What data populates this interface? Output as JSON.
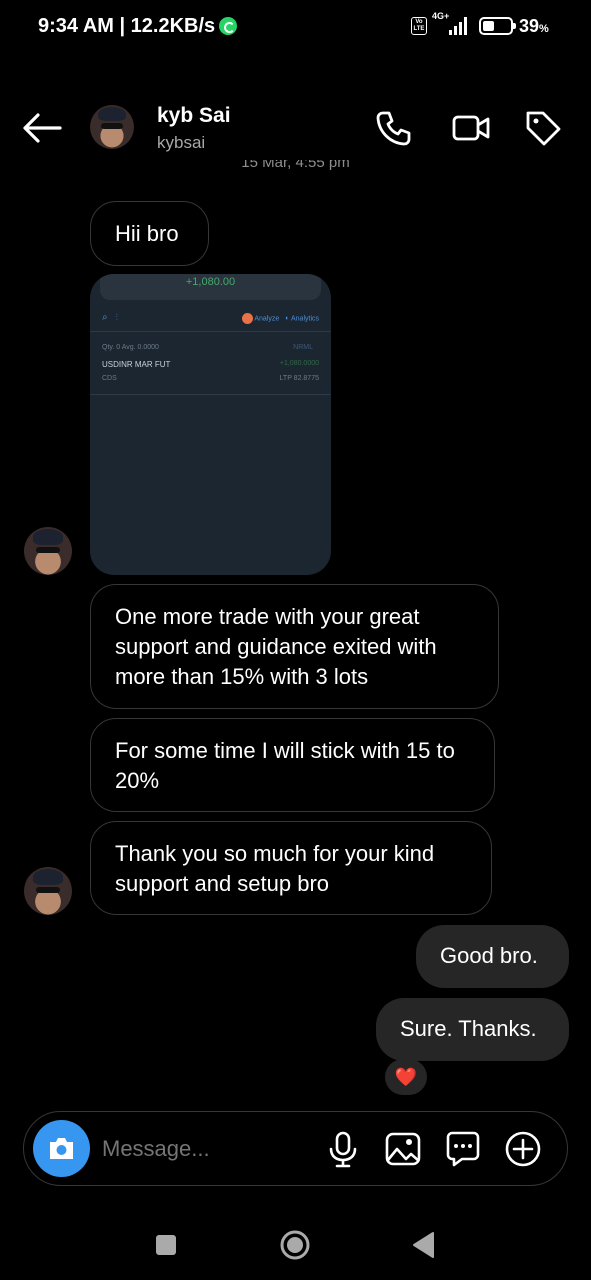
{
  "status_bar": {
    "time": "9:34 AM | 12.2KB/s",
    "volte": "Vo LTE",
    "network": "4G+",
    "battery": "39",
    "battery_unit": "%"
  },
  "header": {
    "name": "kyb Sai",
    "handle": "kybsai",
    "date_peek": "15 Mar, 4:55 pm"
  },
  "messages": {
    "m1": "Hii bro",
    "m2": "One more trade with your great support and guidance exited with more than 15% with 3 lots",
    "m3": "For some time I will stick with 15 to 20%",
    "m4": "Thank you so much for your kind support and setup bro",
    "m5": "Good bro.",
    "m6": "Sure. Thanks.",
    "reaction": "❤️"
  },
  "shared_screenshot": {
    "profit": "+1,080.00",
    "analyze": "Analyze",
    "analytics": "Analytics",
    "qty": "Qty. 0  Avg. 0.0000",
    "nrml": "NRML",
    "instrument": "USDINR MAR FUT",
    "pnl": "+1,080.0000",
    "exchange": "CDS",
    "ltp": "LTP 82.8775"
  },
  "composer": {
    "placeholder": "Message..."
  },
  "colors": {
    "accent": "#3797f0",
    "outgoing_bubble": "#262626",
    "incoming_border": "#363636",
    "profit_green": "#44a96a"
  },
  "icons": {
    "back": "arrow-left-icon",
    "call": "phone-icon",
    "video": "video-camera-icon",
    "tag": "tag-icon",
    "camera": "camera-icon",
    "mic": "microphone-icon",
    "gallery": "image-icon",
    "sticker": "chat-bubble-icon",
    "more": "plus-circle-icon"
  }
}
